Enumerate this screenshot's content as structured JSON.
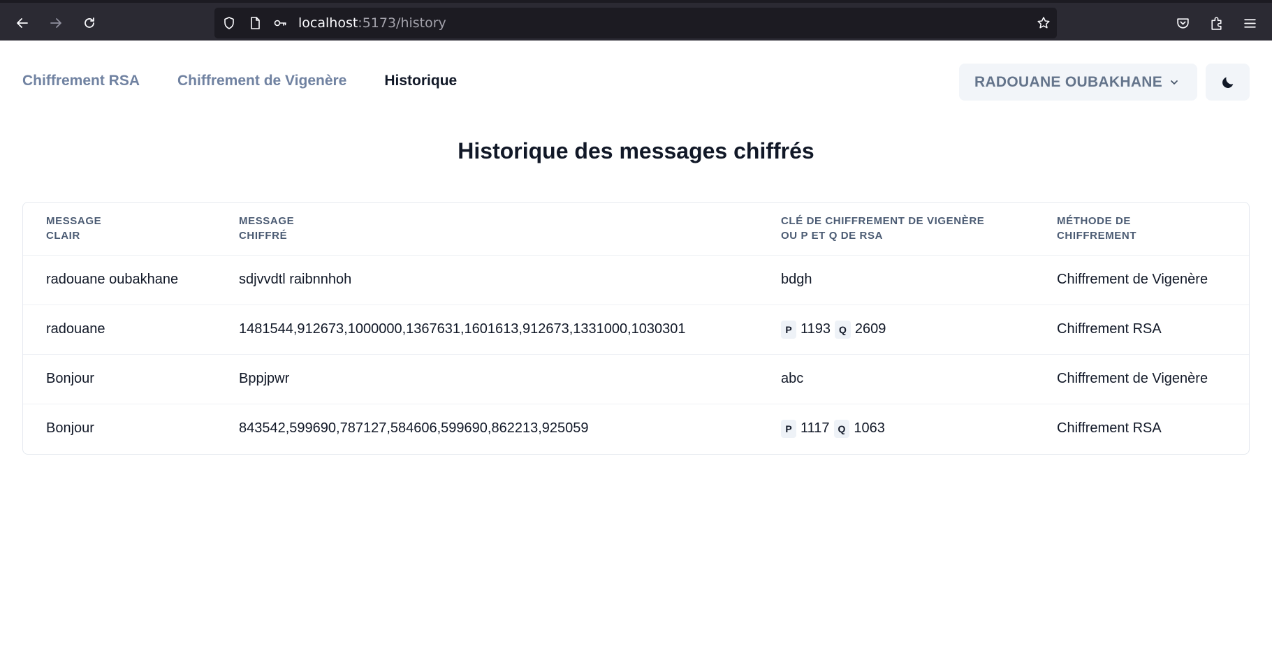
{
  "browser": {
    "url_host": "localhost",
    "url_path": ":5173/history"
  },
  "nav": {
    "links": [
      {
        "label": "Chiffrement RSA"
      },
      {
        "label": "Chiffrement de Vigenère"
      },
      {
        "label": "Historique"
      }
    ],
    "active_index": 2
  },
  "user": {
    "name": "RADOUANE OUBAKHANE"
  },
  "page": {
    "title": "Historique des messages chiffrés"
  },
  "table": {
    "headers": {
      "plain": [
        "MESSAGE",
        "CLAIR"
      ],
      "cipher": [
        "MESSAGE",
        "CHIFFRÉ"
      ],
      "key": [
        "CLÉ DE CHIFFREMENT DE VIGENÈRE",
        "OU P ET Q DE RSA"
      ],
      "method": [
        "MÉTHODE DE",
        "CHIFFREMENT"
      ]
    },
    "rows": [
      {
        "plain": "radouane oubakhane",
        "cipher": "sdjvvdtl raibnnhoh",
        "key": "bdgh",
        "method": "Chiffrement de Vigenère"
      },
      {
        "plain": "radouane",
        "cipher": "1481544,912673,1000000,1367631,1601613,912673,1331000,1030301",
        "p_label": "P",
        "p": "1193",
        "q_label": "Q",
        "q": "2609",
        "method": "Chiffrement RSA"
      },
      {
        "plain": "Bonjour",
        "cipher": "Bppjpwr",
        "key": "abc",
        "method": "Chiffrement de Vigenère"
      },
      {
        "plain": "Bonjour",
        "cipher": "843542,599690,787127,584606,599690,862213,925059",
        "p_label": "P",
        "p": "1117",
        "q_label": "Q",
        "q": "1063",
        "method": "Chiffrement RSA"
      }
    ]
  },
  "colors": {
    "chrome_bg": "#2b2a33",
    "url_bg": "#1c1b22",
    "nav_inactive": "#7082a1",
    "nav_active": "#111827",
    "header_text": "#4b5b73",
    "badge_bg": "#eef2f7",
    "button_bg": "#f2f5f9"
  },
  "icons": {
    "back": "arrow-left-icon",
    "forward": "arrow-right-icon",
    "reload": "reload-icon",
    "shield": "shield-icon",
    "page": "page-icon",
    "key": "key-icon",
    "star": "star-icon",
    "pocket": "pocket-icon",
    "extensions": "puzzle-icon",
    "menu": "hamburger-menu-icon",
    "chevron": "chevron-down-icon",
    "theme": "moon-icon"
  }
}
